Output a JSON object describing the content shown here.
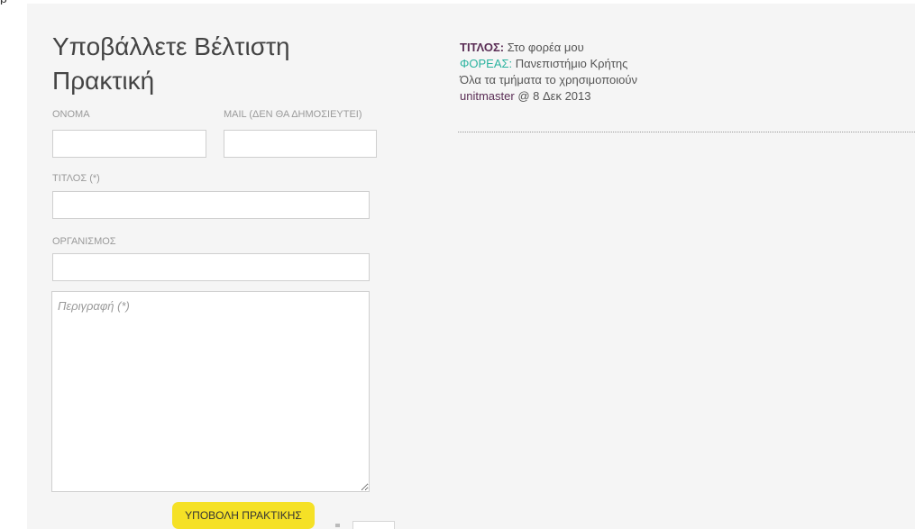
{
  "top_fragment": "p",
  "form": {
    "title": "Υποβάλλετε Βέλτιστη Πρακτική",
    "name_label": "ΟΝΟΜΑ",
    "name_value": "",
    "mail_label": "MAIL (ΔΕΝ ΘΑ ΔΗΜΟΣΙΕΥΤΕΙ)",
    "mail_value": "",
    "title_label": "ΤΙΤΛΟΣ (*)",
    "title_value": "",
    "organization_label": "ΟΡΓΑΝΙΣΜΟΣ",
    "organization_value": "",
    "description_placeholder": "Περιγραφή (*)",
    "description_value": "",
    "submit_label": "ΥΠΟΒΟΛΗ ΠΡΑΚΤΙΚΗΣ"
  },
  "record": {
    "title_key": "ΤΙΤΛΟΣ:",
    "title_value": "Στο φορέα μου",
    "organization_key": "ΦΟΡΕΑΣ:",
    "organization_value": "Πανεπιστήμιο Κρήτης",
    "description": "Όλα τα τμήματα το χρησιμοποιούν",
    "author": "unitmaster",
    "date_text": "@ 8 Δεκ 2013"
  },
  "colors": {
    "panel_background": "#f5f5f5",
    "submit_button": "#f5e126",
    "record_key": "#5a2d55",
    "organization_key": "#2bb39f"
  }
}
